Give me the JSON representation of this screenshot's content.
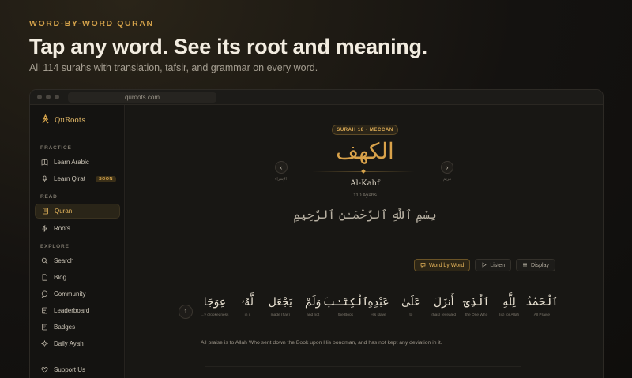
{
  "hero": {
    "eyebrow": "WORD-BY-WORD QURAN",
    "title": "Tap any word. See its root and meaning.",
    "subtitle": "All 114 surahs with translation, tafsir, and grammar on every word."
  },
  "browser": {
    "url": "quroots.com"
  },
  "sidebar": {
    "logo_text": "QuRoots",
    "sections": [
      {
        "label": "PRACTICE",
        "items": [
          {
            "label": "Learn Arabic",
            "icon": "book-icon"
          },
          {
            "label": "Learn Qirat",
            "icon": "microphone-icon",
            "badge": "SOON"
          }
        ]
      },
      {
        "label": "READ",
        "items": [
          {
            "label": "Quran",
            "icon": "quran-book-icon",
            "active": true
          },
          {
            "label": "Roots",
            "icon": "lightning-icon"
          }
        ]
      },
      {
        "label": "EXPLORE",
        "items": [
          {
            "label": "Search",
            "icon": "search-icon"
          },
          {
            "label": "Blog",
            "icon": "document-icon"
          },
          {
            "label": "Community",
            "icon": "chat-icon"
          },
          {
            "label": "Leaderboard",
            "icon": "list-icon"
          },
          {
            "label": "Badges",
            "icon": "badge-icon"
          },
          {
            "label": "Daily Ayah",
            "icon": "sparkle-icon"
          }
        ]
      }
    ],
    "footer_item": {
      "label": "Support Us",
      "icon": "heart-icon"
    }
  },
  "surah": {
    "badge": "SURAH 18 · MECCAN",
    "arabic_name": "الكهف",
    "transliteration": "Al-Kahf",
    "ayah_count": "110 Ayahs",
    "prev_label": "الإسراء",
    "next_label": "مريم",
    "bismillah": "بِسْمِ ٱللَّهِ ٱلرَّحْمَـٰنِ ٱلرَّحِيمِ"
  },
  "toolbar": {
    "word_by_word": "Word by Word",
    "listen": "Listen",
    "display": "Display"
  },
  "verse": {
    "number": "1",
    "words": [
      {
        "ar": "ٱلْحَمْدُ",
        "en": "All Praise"
      },
      {
        "ar": "لِلَّهِ",
        "en": "(is) for Allah"
      },
      {
        "ar": "ٱلَّذِىٓ",
        "en": "the One Who"
      },
      {
        "ar": "أَنزَلَ",
        "en": "(has) revealed"
      },
      {
        "ar": "عَلَىٰ",
        "en": "to"
      },
      {
        "ar": "عَبْدِهِ",
        "en": "His slave"
      },
      {
        "ar": "ٱلْكِتَـٰبَ",
        "en": "the Book"
      },
      {
        "ar": "وَلَمْ",
        "en": "and not"
      },
      {
        "ar": "يَجْعَل",
        "en": "made (has)"
      },
      {
        "ar": "لَّهُۥ",
        "en": "in it"
      },
      {
        "ar": "عِوَجَا",
        "en": "...y crookedness"
      }
    ],
    "translation": "All praise is to Allah Who sent down the Book upon His bondman, and has not kept any deviation in it."
  }
}
